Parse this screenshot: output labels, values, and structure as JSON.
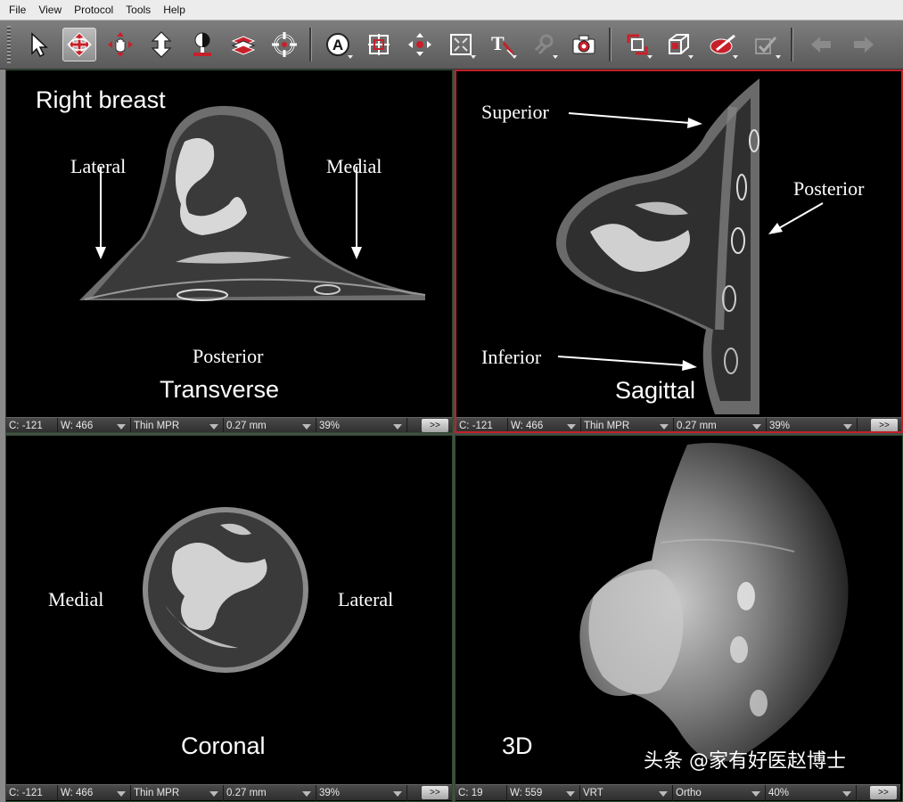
{
  "menu": [
    "File",
    "View",
    "Protocol",
    "Tools",
    "Help"
  ],
  "toolbar": {
    "tools": [
      {
        "icon": "select-arrow-icon",
        "active": false
      },
      {
        "icon": "rotate-3d-icon",
        "active": true
      },
      {
        "icon": "pan-hand-icon",
        "active": false
      },
      {
        "icon": "zoom-icon",
        "active": false
      },
      {
        "icon": "window-level-icon",
        "active": false
      },
      {
        "icon": "slab-scroll-icon",
        "active": false
      },
      {
        "icon": "crosshair-icon",
        "active": false
      },
      {
        "icon": "annotation-icon",
        "active": false
      },
      {
        "icon": "layout-icon",
        "active": false
      },
      {
        "icon": "move-points-icon",
        "active": false
      },
      {
        "icon": "fit-view-icon",
        "active": false
      },
      {
        "icon": "text-icon",
        "active": false
      },
      {
        "icon": "link-icon",
        "active": false
      },
      {
        "icon": "camera-icon",
        "active": false
      },
      {
        "icon": "orientation-icon",
        "active": false
      },
      {
        "icon": "cube-icon",
        "active": false
      },
      {
        "icon": "scalpel-icon",
        "active": false
      },
      {
        "icon": "apply-icon",
        "active": false
      },
      {
        "icon": "back-arrow-icon",
        "active": false
      },
      {
        "icon": "forward-arrow-icon",
        "active": false
      }
    ],
    "accent": "#c0202a"
  },
  "viewports": {
    "transverse": {
      "title": "Right breast",
      "label": "Transverse",
      "lateral": "Lateral",
      "medial": "Medial",
      "posterior": "Posterior",
      "status": {
        "c": "C: -121",
        "w": "W:  466",
        "mode": "Thin MPR",
        "thickness": "0.27 mm",
        "zoom": "39%",
        "more": ">>"
      }
    },
    "sagittal": {
      "label": "Sagittal",
      "superior": "Superior",
      "posterior": "Posterior",
      "inferior": "Inferior",
      "status": {
        "c": "C: -121",
        "w": "W:  466",
        "mode": "Thin MPR",
        "thickness": "0.27 mm",
        "zoom": "39%",
        "more": ">>"
      }
    },
    "coronal": {
      "label": "Coronal",
      "medial": "Medial",
      "lateral": "Lateral",
      "status": {
        "c": "C: -121",
        "w": "W:  466",
        "mode": "Thin MPR",
        "thickness": "0.27 mm",
        "zoom": "39%",
        "more": ">>"
      }
    },
    "three_d": {
      "label": "3D",
      "watermark": "头条 @家有好医赵博士",
      "status": {
        "c": "C:  19",
        "w": "W:  559",
        "mode": "VRT",
        "projection": "Ortho",
        "zoom": "40%",
        "more": ">>"
      }
    }
  }
}
